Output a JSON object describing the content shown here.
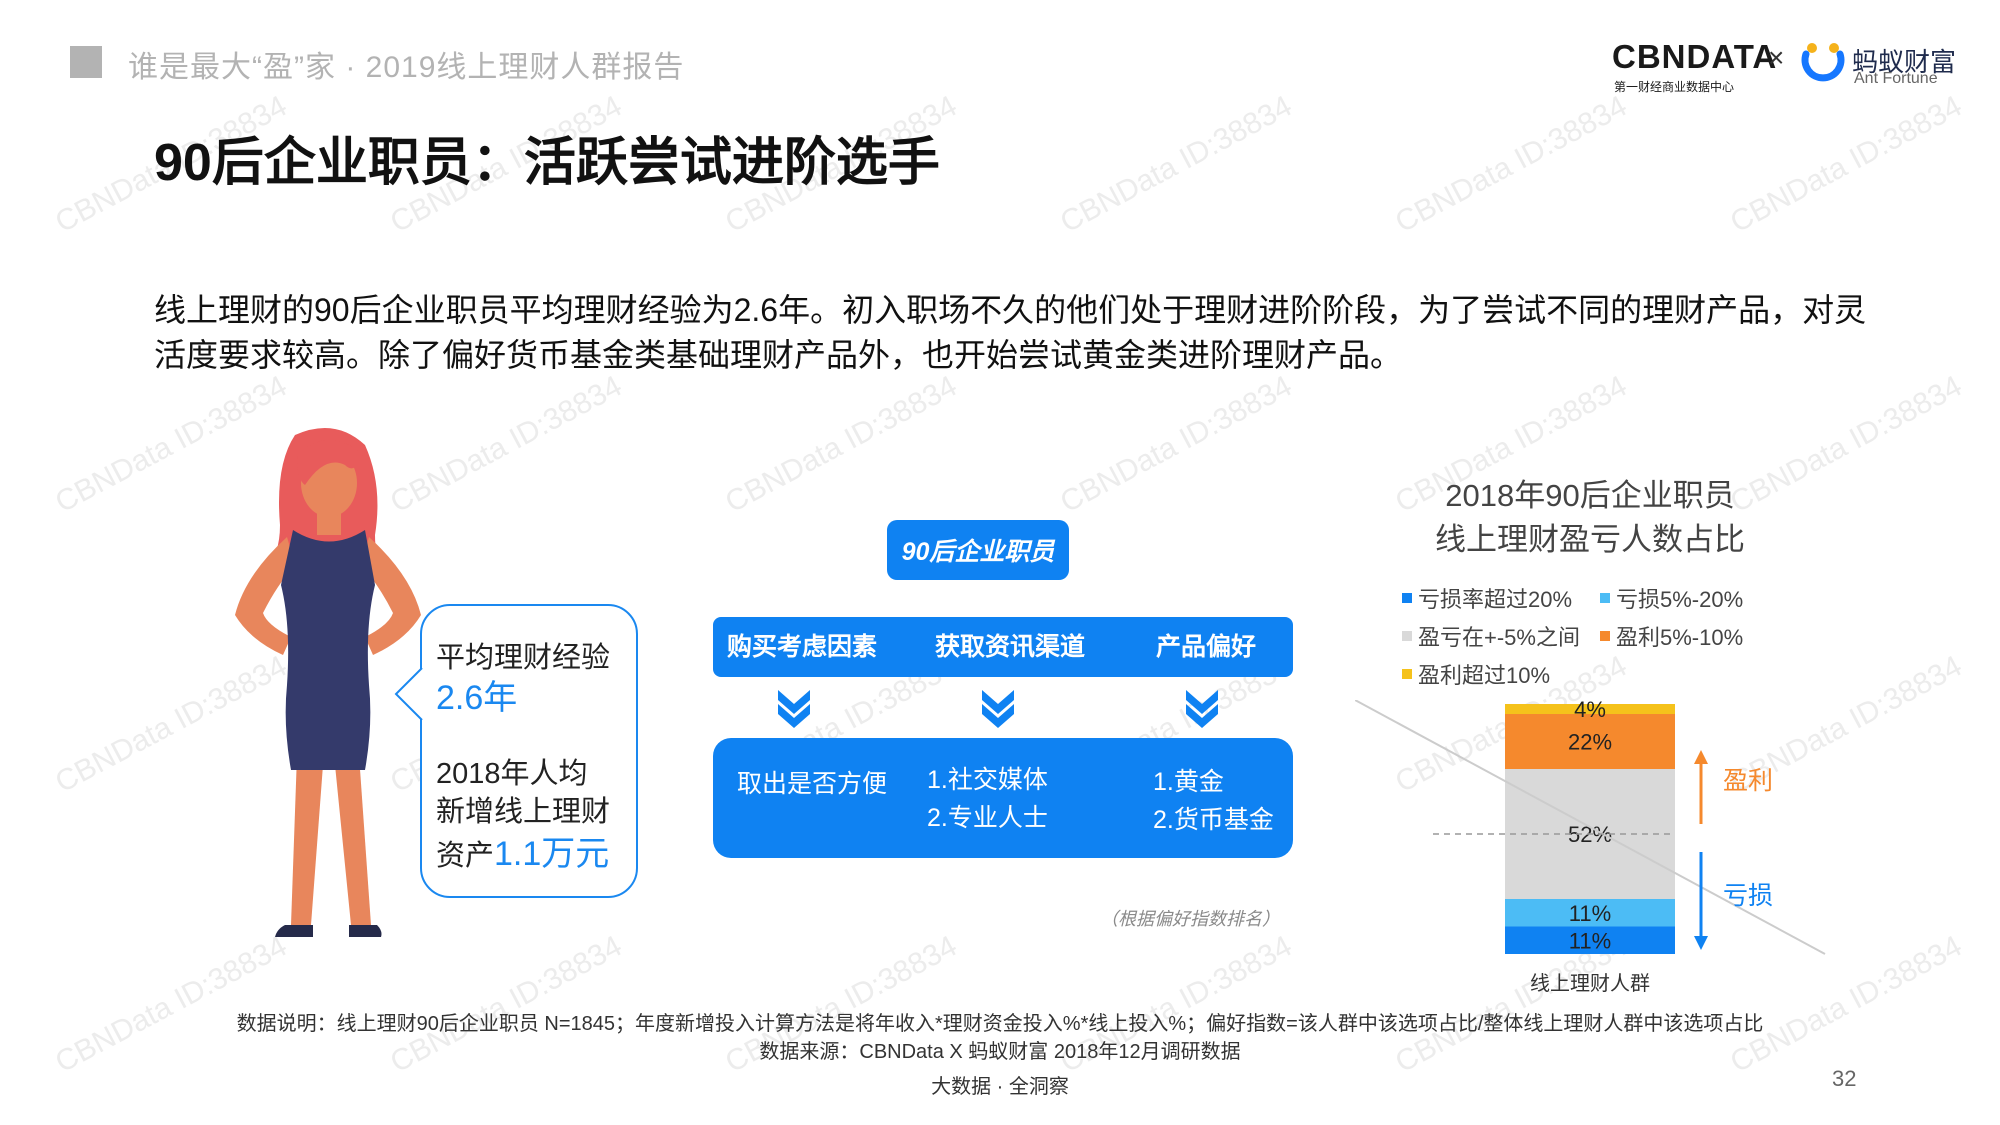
{
  "header": {
    "report_title": "谁是最大“盈”家 · 2019线上理财人群报告",
    "logo_cbn": "CBNDATA",
    "logo_cbn_sub": "第一财经商业数据中心",
    "logo_x": "×",
    "logo_ant_cn": "蚂蚁财富",
    "logo_ant_en": "Ant Fortune"
  },
  "watermark": "CBNData ID:38834",
  "title": "90后企业职员：活跃尝试进阶选手",
  "description": "线上理财的90后企业职员平均理财经验为2.6年。初入职场不久的他们处于理财进阶阶段，为了尝试不同的理财产品，对灵活度要求较高。除了偏好货币基金类基础理财产品外，也开始尝试黄金类进阶理财产品。",
  "callout": {
    "exp_label": "平均理财经验",
    "exp_value": "2.6年",
    "asset_line1": "2018年人均",
    "asset_line2": "新增线上理财",
    "asset_prefix": "资产",
    "asset_value": "1.1万元"
  },
  "diagram": {
    "segment": "90后企业职员",
    "headers": [
      "购买考虑因素",
      "获取资讯渠道",
      "产品偏好"
    ],
    "results": {
      "factor": "取出是否方便",
      "channel_1": "1.社交媒体",
      "channel_2": "2.专业人士",
      "product_1": "1.黄金",
      "product_2": "2.货币基金"
    },
    "note": "（根据偏好指数排名）"
  },
  "chart_data": {
    "type": "bar",
    "stacked": true,
    "title_line1": "2018年90后企业职员",
    "title_line2": "线上理财盈亏人数占比",
    "categories": [
      "线上理财人群"
    ],
    "series": [
      {
        "name": "亏损率超过20%",
        "values": [
          11
        ],
        "label": "11%",
        "color": "#0f82f2"
      },
      {
        "name": "亏损5%-20%",
        "values": [
          11
        ],
        "label": "11%",
        "color": "#4cbcf5"
      },
      {
        "name": "盈亏在+-5%之间",
        "values": [
          52
        ],
        "label": "52%",
        "color": "#d9d9d9"
      },
      {
        "name": "盈利5%-10%",
        "values": [
          22
        ],
        "label": "22%",
        "color": "#f5892d"
      },
      {
        "name": "盈利超过10%",
        "values": [
          4
        ],
        "label": "4%",
        "color": "#f5c21b"
      }
    ],
    "ylim": [
      0,
      100
    ],
    "annotations": {
      "profit": "盈利",
      "loss": "亏损"
    },
    "colors": {
      "profit": "#f5892d",
      "loss": "#0f82f2"
    }
  },
  "footer": {
    "data_note": "数据说明：线上理财90后企业职员 N=1845；年度新增投入计算方法是将年收入*理财资金投入%*线上投入%；偏好指数=该人群中该选项占比/整体线上理财人群中该选项占比",
    "data_source": "数据来源：CBNData X 蚂蚁财富 2018年12月调研数据",
    "tagline": "大数据 · 全洞察",
    "page_number": "32"
  }
}
